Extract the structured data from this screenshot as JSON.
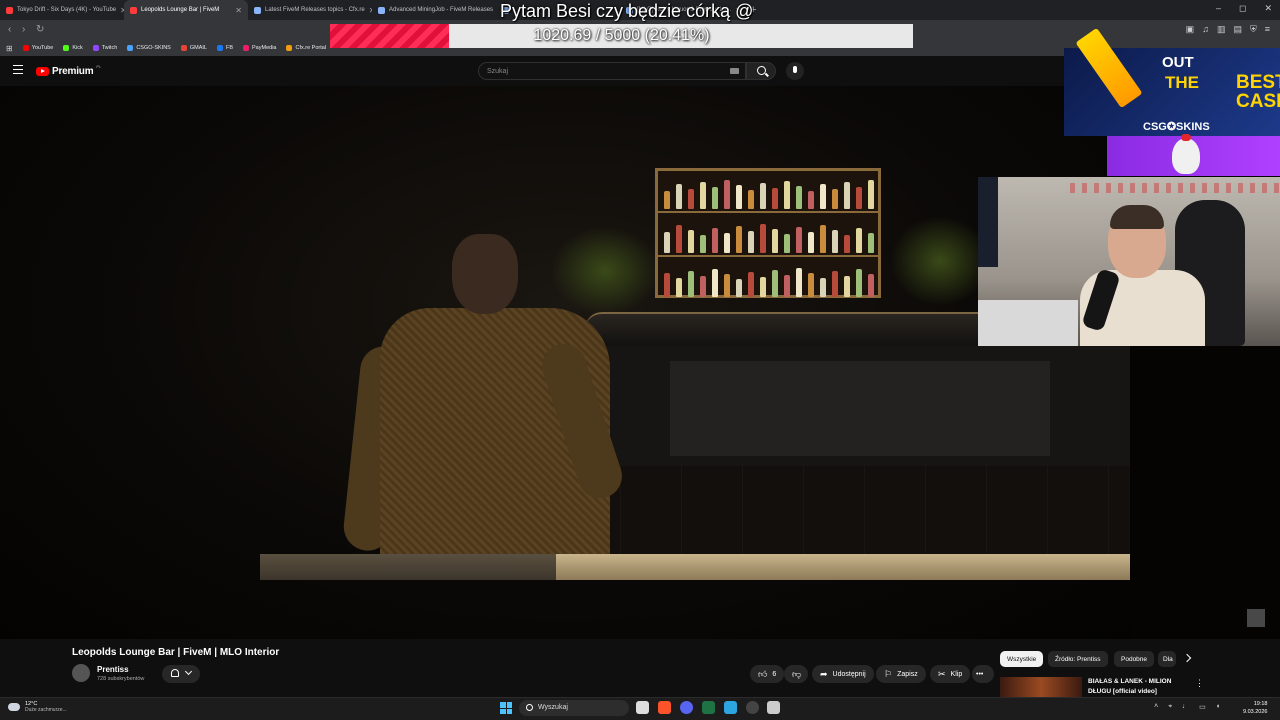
{
  "browser": {
    "tabs": [
      {
        "title": "Tokyo Drift - Six Days (4K) - YouTube",
        "active": false,
        "icon": "youtube-icon"
      },
      {
        "title": "Leopolds Lounge Bar | FiveM",
        "active": true,
        "icon": "youtube-icon"
      },
      {
        "title": "Latest FiveM Releases topics - Cfx.re",
        "active": false,
        "icon": "doc-icon"
      },
      {
        "title": "Advanced MiningJob - FiveM Releases",
        "active": false,
        "icon": "doc-icon"
      },
      {
        "title": "",
        "active": false,
        "icon": "doc-icon"
      },
      {
        "title": "[MLO] Rob's Liquor & Brewery La...",
        "active": false,
        "icon": "doc-icon"
      }
    ],
    "new_tab": "+",
    "window_controls": {
      "minimize": "–",
      "maximize": "◻",
      "close": "✕"
    },
    "bookmarks": [
      {
        "label": "YouTube",
        "color": "#ff0000"
      },
      {
        "label": "Kick",
        "color": "#53fc18"
      },
      {
        "label": "Twitch",
        "color": "#9146ff"
      },
      {
        "label": "CSGO-SKINS",
        "color": "#4aa3ff"
      },
      {
        "label": "GMAIL",
        "color": "#ea4335"
      },
      {
        "label": "FB",
        "color": "#1877f2"
      },
      {
        "label": "PayMedia",
        "color": "#e91e63"
      },
      {
        "label": "Cfx.re Portal",
        "color": "#f39c12"
      }
    ]
  },
  "overlay": {
    "title": "Pytam Besi czy będzie córką @",
    "goal_text": "1020.69 / 5000 (20.41%)",
    "goal_progress": 0.2041,
    "ad": {
      "line1": "OUT",
      "line2": "THE",
      "line3": "BEST",
      "line4": "CASE",
      "brand": "CSG✪SKINS"
    }
  },
  "youtube": {
    "logo": "Premium",
    "logo_region": "PL",
    "search_placeholder": "Szukaj",
    "video_title": "Leopolds Lounge Bar | FiveM | MLO Interior",
    "channel": {
      "name": "Prentiss",
      "subs": "728 subskrybentów"
    },
    "actions": {
      "likes": "6",
      "share": "Udostępnij",
      "save": "Zapisz",
      "clip": "Klip",
      "more": "•••"
    },
    "chips": [
      "Wszystkie",
      "Źródło: Prentiss",
      "Podobne",
      "Dla"
    ],
    "recommended": {
      "title_line1": "BIAŁAS & LANEK - MILION",
      "title_line2": "DŁUGU [official video]"
    }
  },
  "taskbar": {
    "weather_temp": "12°C",
    "weather_desc": "Duże zachmurze...",
    "search_label": "Wyszukaj",
    "time": "19:18",
    "date": "9.03.2026"
  }
}
